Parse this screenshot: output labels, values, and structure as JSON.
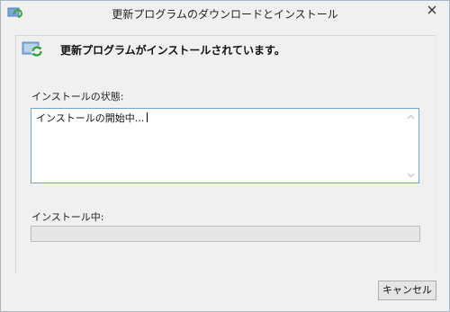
{
  "window": {
    "title": "更新プログラムのダウンロードとインストール",
    "app_icon": "windows-update-icon",
    "close_icon": "close-icon"
  },
  "header": {
    "icon": "update-install-icon",
    "text": "更新プログラムがインストールされています。"
  },
  "status": {
    "label": "インストールの状態:",
    "log_text": "インストールの開始中..."
  },
  "progress": {
    "label": "インストール中:",
    "value": 0
  },
  "buttons": {
    "cancel_label": "キャンセル"
  },
  "colors": {
    "window_bg": "#f0f0f0",
    "border": "#a9b6c4",
    "focus_border": "#6fa3d8",
    "progress_track": "#e6e6e6",
    "progress_fill": "#06b025"
  }
}
